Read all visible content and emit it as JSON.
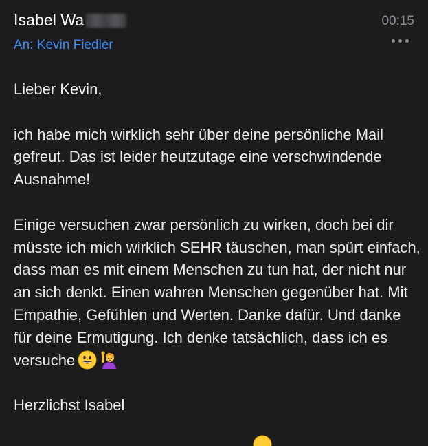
{
  "header": {
    "sender_name": "Isabel Wa",
    "time": "00:15",
    "recipient": "An: Kevin Fiedler",
    "more_icon": "ellipsis-icon"
  },
  "message": {
    "greeting": "Lieber Kevin,",
    "paragraph1": "ich habe mich wirklich sehr über deine persönliche Mail gefreut. Das ist leider heutzutage eine verschwindende Ausnahme!",
    "paragraph2": "Einige versuchen zwar persönlich zu wirken, doch bei dir müsste ich mich wirklich SEHR täuschen, man spürt einfach, dass man es mit einem Menschen zu tun hat, der nicht nur an sich denkt. Einen wahren Menschen gegenüber hat. Mit Empathie, Gefühlen und Werten. Danke dafür. Und danke für deine Ermutigung. Ich denke tatsächlich, dass ich es versuche",
    "paragraph2_emojis": [
      "smiley-emoji",
      "person-raising-hand-emoji"
    ],
    "closing": "Herzlichst Isabel"
  },
  "colors": {
    "background": "#1c1c1e",
    "link": "#3d8bf2",
    "muted": "#8e8e93",
    "text": "#ececee"
  }
}
